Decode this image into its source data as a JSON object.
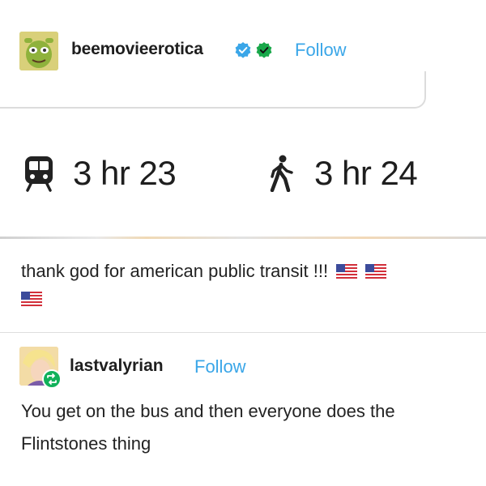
{
  "post": {
    "username": "beemovieerotica",
    "follow_label": "Follow",
    "badges": [
      {
        "icon": "blue-verified-check-icon",
        "color": "#3aa6e8"
      },
      {
        "icon": "green-verified-check-icon",
        "color": "#19a84a"
      }
    ],
    "embedded": {
      "transit": {
        "icon": "train-icon",
        "label": "3 hr 23"
      },
      "walk": {
        "icon": "walking-person-icon",
        "label": "3 hr 24"
      }
    },
    "body": "thank god for american public transit !!!",
    "emoji_flags": [
      "us-flag-icon",
      "us-flag-icon",
      "us-flag-icon"
    ]
  },
  "reblog": {
    "username": "lastvalyrian",
    "follow_label": "Follow",
    "reblog_icon": "reblog-arrows-icon",
    "body": "You get on the bus and then everyone does the Flintstones thing"
  },
  "colors": {
    "follow": "#3aa6e8",
    "text": "#222222",
    "reblog_badge": "#11b15a"
  }
}
